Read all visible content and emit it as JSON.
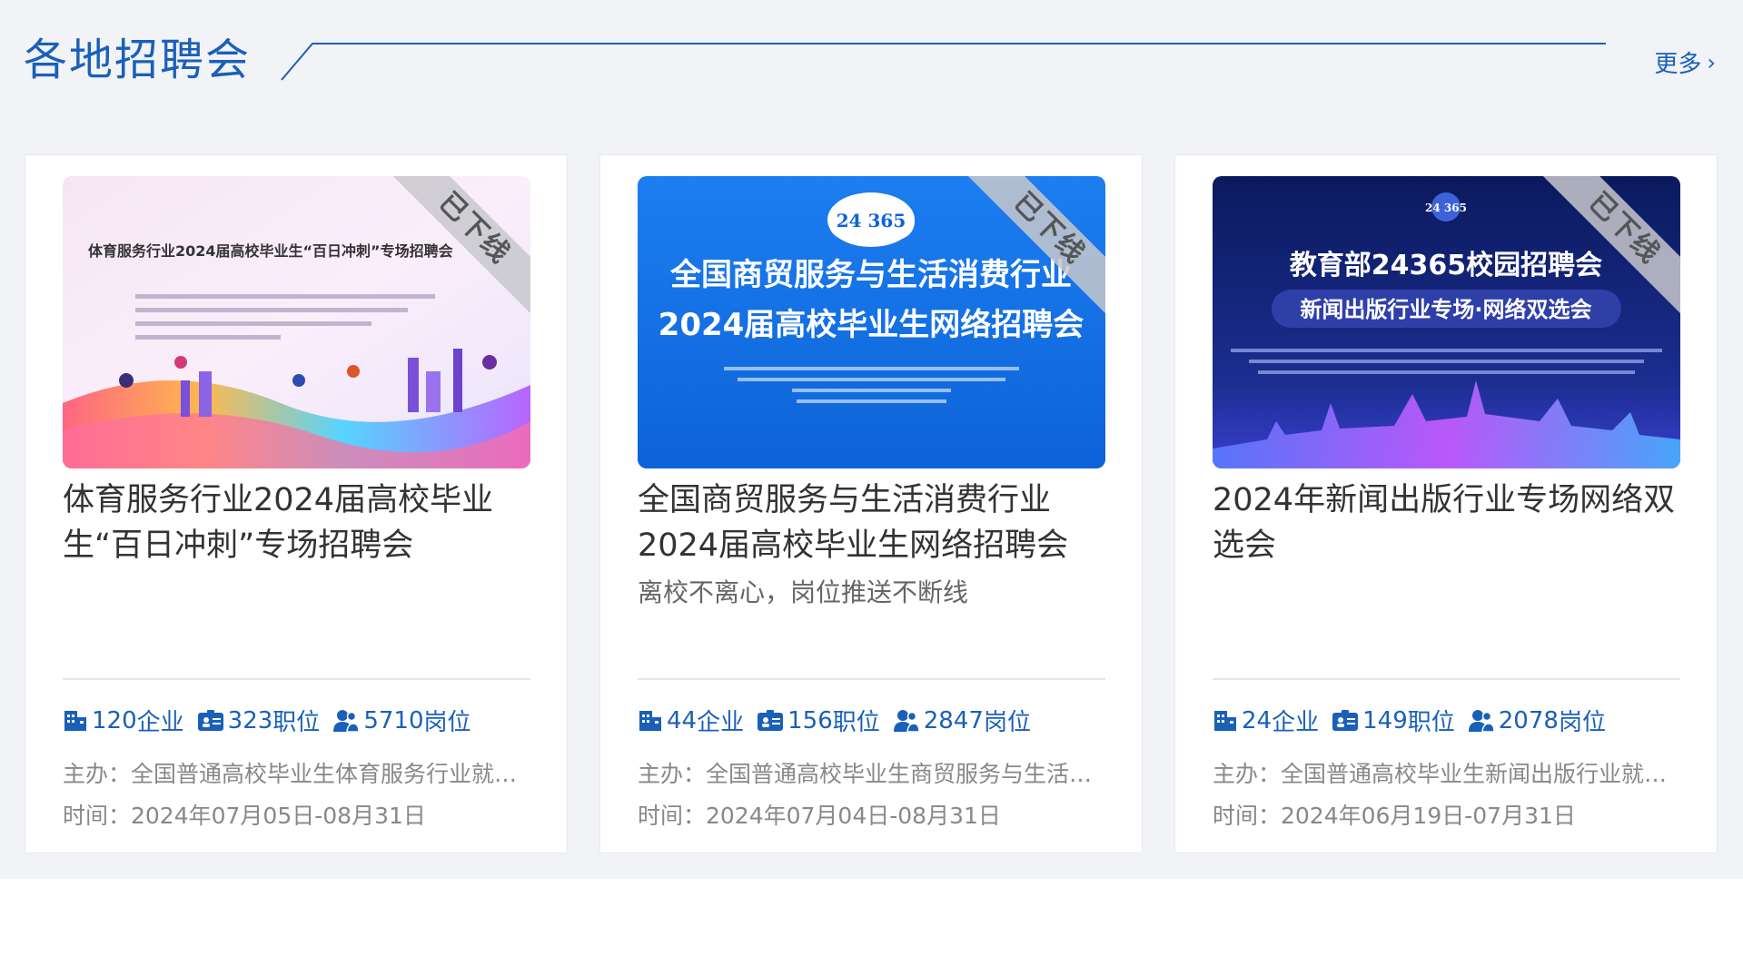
{
  "section": {
    "title": "各地招聘会",
    "more_label": "更多"
  },
  "colors": {
    "accent": "#1a60b8",
    "section_bg": "#f1f3f6"
  },
  "cards": [
    {
      "image_caption": "体育服务行业2024届高校毕业生“百日冲刺”专场招聘会",
      "ribbon": "已下线",
      "title": "体育服务行业2024届高校毕业生“百日冲刺”专场招聘会",
      "subtitle": "",
      "companies_num": "120",
      "companies_unit": "企业",
      "positions_num": "323",
      "positions_unit": "职位",
      "posts_num": "5710",
      "posts_unit": "岗位",
      "organizer": "主办：全国普通高校毕业生体育服务行业就业创业指导委员会",
      "time": "时间：2024年07月05日-08月31日"
    },
    {
      "image_caption_line1": "全国商贸服务与生活消费行业",
      "image_caption_line2": "2024届高校毕业生网络招聘会",
      "image_badge": "24 365",
      "ribbon": "已下线",
      "title": "全国商贸服务与生活消费行业2024届高校毕业生网络招聘会",
      "subtitle": "离校不离心，岗位推送不断线",
      "companies_num": "44",
      "companies_unit": "企业",
      "positions_num": "156",
      "positions_unit": "职位",
      "posts_num": "2847",
      "posts_unit": "岗位",
      "organizer": "主办：全国普通高校毕业生商贸服务与生活消费行业就业创业指导委员会",
      "time": "时间：2024年07月04日-08月31日"
    },
    {
      "image_caption_line1": "教育部24365校园招聘会",
      "image_caption_line2": "新闻出版行业专场·网络双选会",
      "image_badge": "24 365",
      "ribbon": "已下线",
      "title": "2024年新闻出版行业专场网络双选会",
      "subtitle": "",
      "companies_num": "24",
      "companies_unit": "企业",
      "positions_num": "149",
      "positions_unit": "职位",
      "posts_num": "2078",
      "posts_unit": "岗位",
      "organizer": "主办：全国普通高校毕业生新闻出版行业就业创业指导委员会",
      "time": "时间：2024年06月19日-07月31日"
    }
  ]
}
